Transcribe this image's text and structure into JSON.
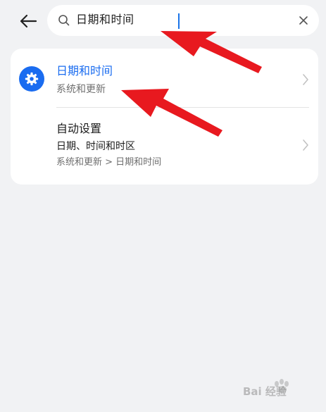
{
  "search": {
    "query": "日期和时间"
  },
  "results": [
    {
      "title": "日期和时间",
      "subtitle": "系统和更新"
    },
    {
      "title": "自动设置",
      "subtitle": "日期、时间和时区",
      "path": "系统和更新 > 日期和时间"
    }
  ],
  "colors": {
    "accent": "#1a6cf0",
    "background": "#f1f2f4",
    "card": "#ffffff",
    "arrow": "#e8191f"
  },
  "icons": {
    "back": "arrow-left",
    "search": "magnifier",
    "clear": "x",
    "result": "gear",
    "chevron": "chevron-right"
  },
  "watermark": {
    "text": "Bai 经验"
  }
}
